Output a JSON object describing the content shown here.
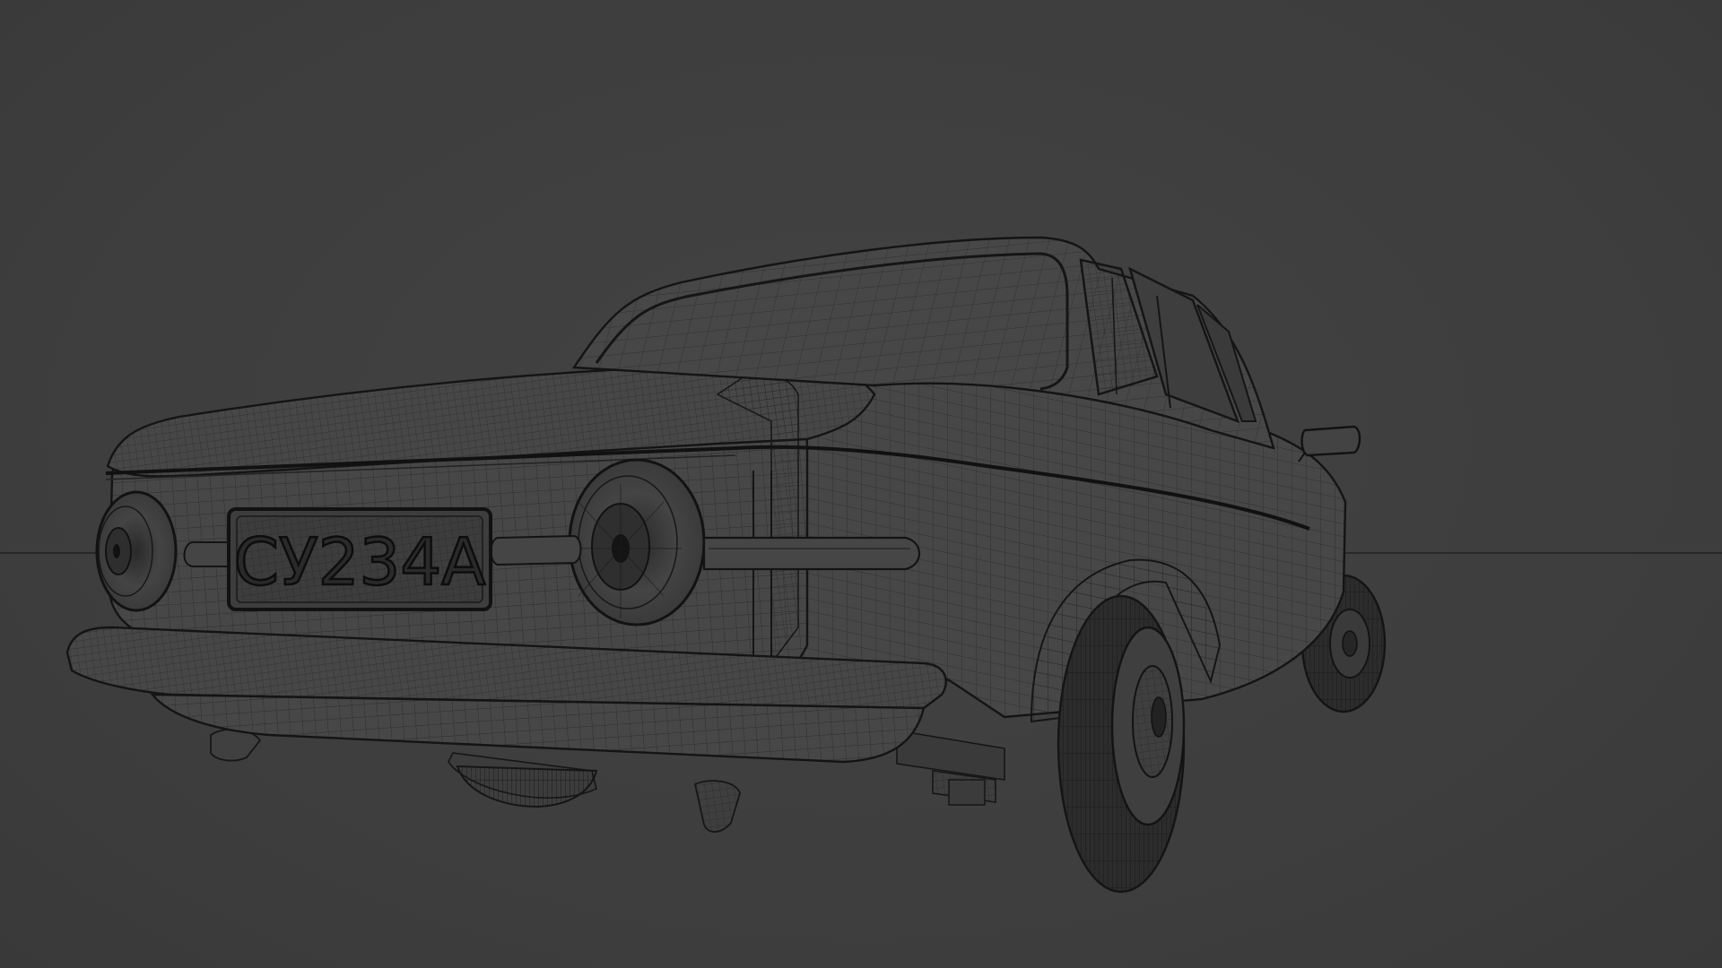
{
  "scene": {
    "subject": "car-wireframe",
    "background_color": "#404040",
    "wire_color": "#1a1a1a"
  },
  "license_plate": {
    "text": "СУ234А"
  }
}
